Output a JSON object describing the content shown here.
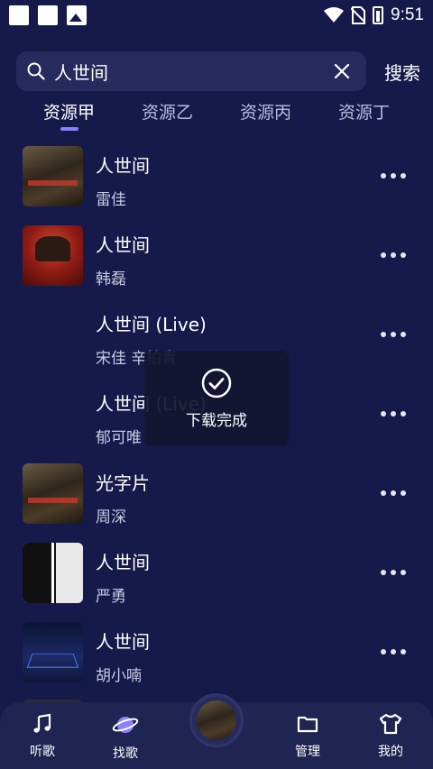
{
  "status_bar": {
    "time": "9:51",
    "icons": [
      "square-icon",
      "square-icon",
      "image-icon",
      "wifi-icon",
      "no-sim-icon",
      "battery-charging-icon"
    ]
  },
  "search": {
    "value": "人世间",
    "placeholder": "",
    "clear_icon": "close-icon",
    "search_button_label": "搜索"
  },
  "tabs": [
    {
      "label": "资源甲",
      "active": true
    },
    {
      "label": "资源乙",
      "active": false
    },
    {
      "label": "资源丙",
      "active": false
    },
    {
      "label": "资源丁",
      "active": false
    }
  ],
  "songs": [
    {
      "title": "人世间",
      "artist": "雷佳",
      "cover": "drama-cover"
    },
    {
      "title": "人世间",
      "artist": "韩磊",
      "cover": "red-poster-cover"
    },
    {
      "title": "人世间 (Live)",
      "artist": "宋佳 辛柏青",
      "cover": ""
    },
    {
      "title": "人世间 (Live)",
      "artist": "郁可唯",
      "cover": ""
    },
    {
      "title": "光字片",
      "artist": "周深",
      "cover": "drama-cover"
    },
    {
      "title": "人世间",
      "artist": "严勇",
      "cover": "black-white-cover"
    },
    {
      "title": "人世间",
      "artist": "胡小喃",
      "cover": "blue-stage-cover"
    }
  ],
  "toast": {
    "icon": "check-circle-icon",
    "text": "下载完成"
  },
  "bottom_nav": [
    {
      "label": "听歌",
      "icon": "music-note-icon"
    },
    {
      "label": "找歌",
      "icon": "planet-icon"
    },
    {
      "label": "",
      "icon": "now-playing-disc"
    },
    {
      "label": "管理",
      "icon": "folder-icon"
    },
    {
      "label": "我的",
      "icon": "shirt-icon"
    }
  ],
  "colors": {
    "background": "#161a4a",
    "search_bg": "#262a5c",
    "accent": "#8d80ff",
    "nav_bg": "#1f2452"
  }
}
